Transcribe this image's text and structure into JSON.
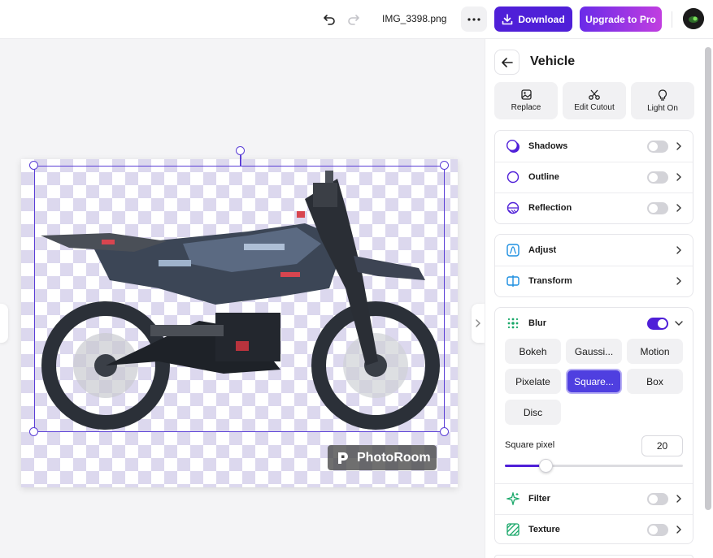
{
  "topbar": {
    "filename": "IMG_3398.png",
    "download_label": "Download",
    "upgrade_label": "Upgrade to Pro"
  },
  "canvas": {
    "watermark_text": "PhotoRoom"
  },
  "panel": {
    "title": "Vehicle",
    "tools": [
      {
        "label": "Replace",
        "icon": "image-icon"
      },
      {
        "label": "Edit Cutout",
        "icon": "scissors-icon"
      },
      {
        "label": "Light On",
        "icon": "lightbulb-icon"
      }
    ],
    "effects": [
      {
        "label": "Shadows",
        "enabled": false
      },
      {
        "label": "Outline",
        "enabled": false
      },
      {
        "label": "Reflection",
        "enabled": false
      }
    ],
    "adjust": [
      {
        "label": "Adjust"
      },
      {
        "label": "Transform"
      }
    ],
    "blur": {
      "label": "Blur",
      "enabled": true,
      "options": [
        "Bokeh",
        "Gaussi...",
        "Motion",
        "Pixelate",
        "Square...",
        "Box",
        "Disc"
      ],
      "selected": "Square...",
      "param_label": "Square pixel",
      "param_value": "20",
      "slider_fraction": 0.23
    },
    "extras": [
      {
        "label": "Filter",
        "enabled": false
      },
      {
        "label": "Texture",
        "enabled": false
      }
    ]
  },
  "colors": {
    "accent": "#4f1fd8",
    "upgrade_gradient_start": "#6a2be8",
    "upgrade_gradient_end": "#c13ee0"
  }
}
